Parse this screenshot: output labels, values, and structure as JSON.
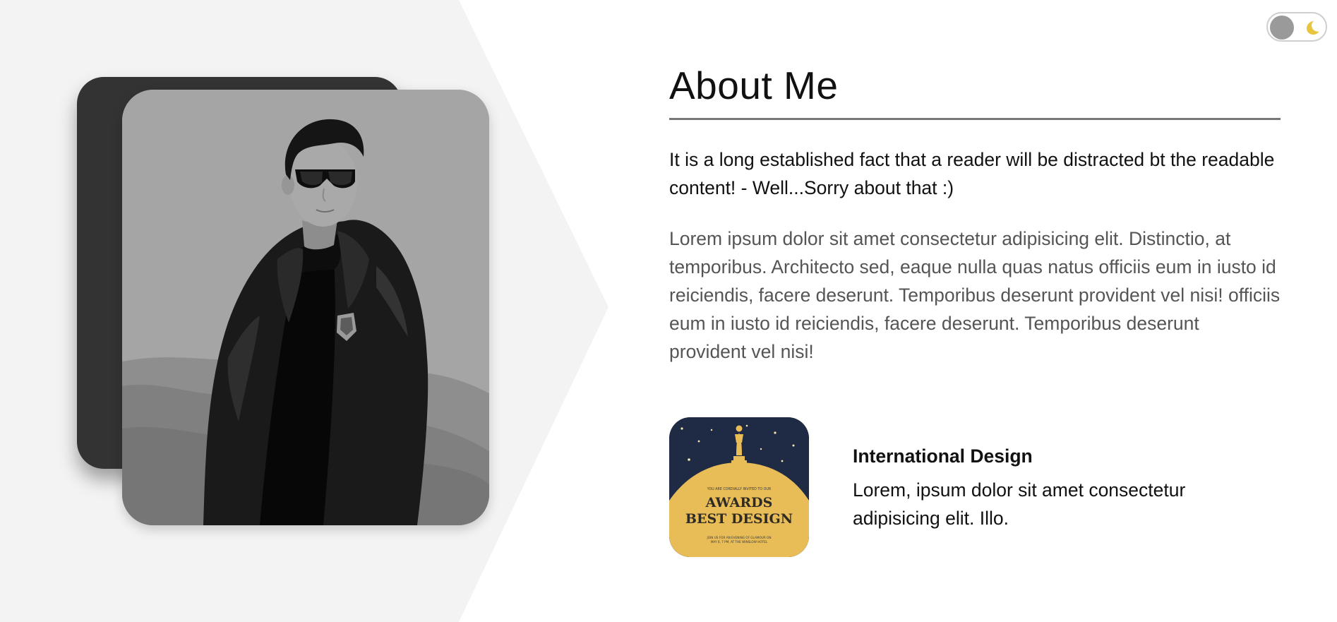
{
  "theme_toggle": {
    "icon": "moon-icon",
    "knob_color": "#9a9a9a",
    "moon_color": "#e8c53a"
  },
  "about": {
    "title": "About Me",
    "lead": "It is a long established fact that a reader will be distracted bt the readable content! - Well...Sorry about that :)",
    "body": "Lorem ipsum dolor sit amet consectetur adipisicing elit. Distinctio, at temporibus. Architecto sed, eaque nulla quas natus officiis eum in iusto id reiciendis, facere deserunt. Temporibus deserunt provident vel nisi! officiis eum in iusto id reiciendis, facere deserunt. Temporibus deserunt provident vel nisi!"
  },
  "award": {
    "image": {
      "small_top_text": "YOU ARE CORDIALLY INVITED TO OUR",
      "headline_1": "AWARDS",
      "headline_2": "BEST DESIGN",
      "small_bottom_1": "JOIN US FOR AN EVENING OF GLAMOUR ON",
      "small_bottom_2": "MAY 6, 7 PM, AT THE WINSLOW HOTEL"
    },
    "title": "International Design",
    "text": "Lorem, ipsum dolor sit amet consectetur adipisicing elit. Illo."
  },
  "colors": {
    "accent_gold": "#e8bd58",
    "navy": "#1f2a44",
    "rule": "#777777",
    "left_bg": "#f3f3f3"
  }
}
